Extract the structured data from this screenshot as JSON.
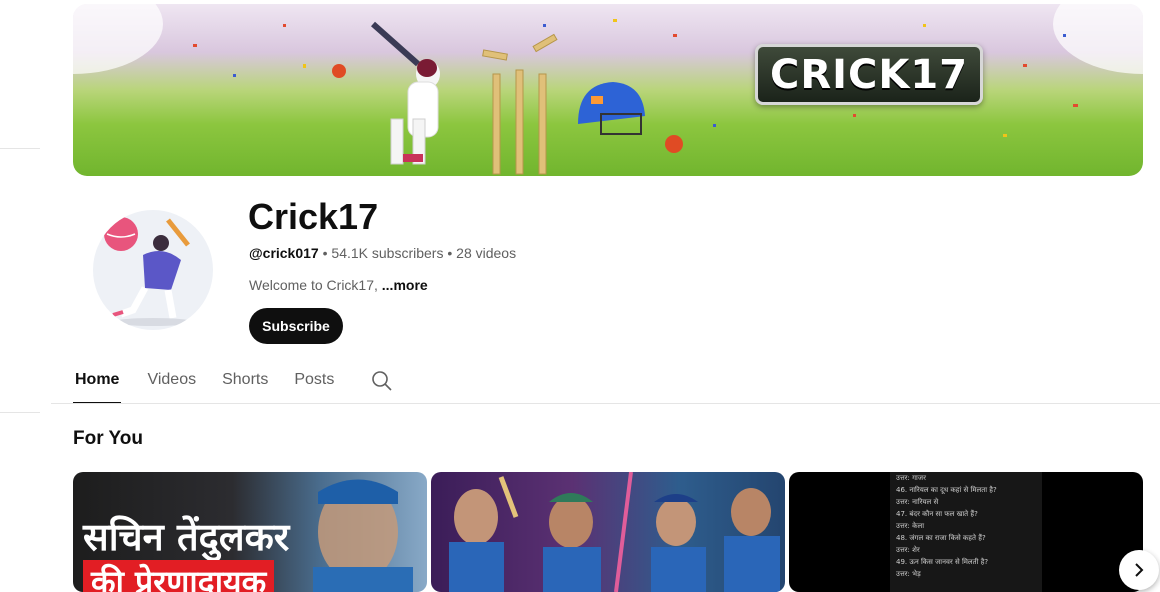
{
  "banner": {
    "logo_text": "CRICK17"
  },
  "channel": {
    "name": "Crick17",
    "handle": "@crick017",
    "separator": "•",
    "subscribers": "54.1K subscribers",
    "videos": "28 videos",
    "description": "Welcome to Crick17, ",
    "more_label": "...more",
    "subscribe_label": "Subscribe"
  },
  "tabs": [
    {
      "label": "Home",
      "active": true
    },
    {
      "label": "Videos",
      "active": false
    },
    {
      "label": "Shorts",
      "active": false
    },
    {
      "label": "Posts",
      "active": false
    }
  ],
  "section": {
    "title": "For You"
  },
  "thumbnails": [
    {
      "title_line1": "सचिन तेंदुलकर",
      "title_line2": "की प्रेरणादायक"
    },
    {},
    {
      "lines": [
        "उत्तर: गाजर",
        "46. नारियल का दूध कहां से मिलता है?",
        "उत्तर: नारियल से",
        "47. बंदर कौन सा फल खाते हैं?",
        "उत्तर: केला",
        "48. जंगल का राजा किसे कहते हैं?",
        "उत्तर: शेर",
        "49. ऊन किस जानवर से मिलती है?",
        "उत्तर: भेड़"
      ]
    }
  ],
  "colors": {
    "subscribe_bg": "#0f0f0f",
    "accent_red": "#e21e24"
  },
  "icons": {
    "search": "search-icon",
    "next": "chevron-right-icon"
  }
}
